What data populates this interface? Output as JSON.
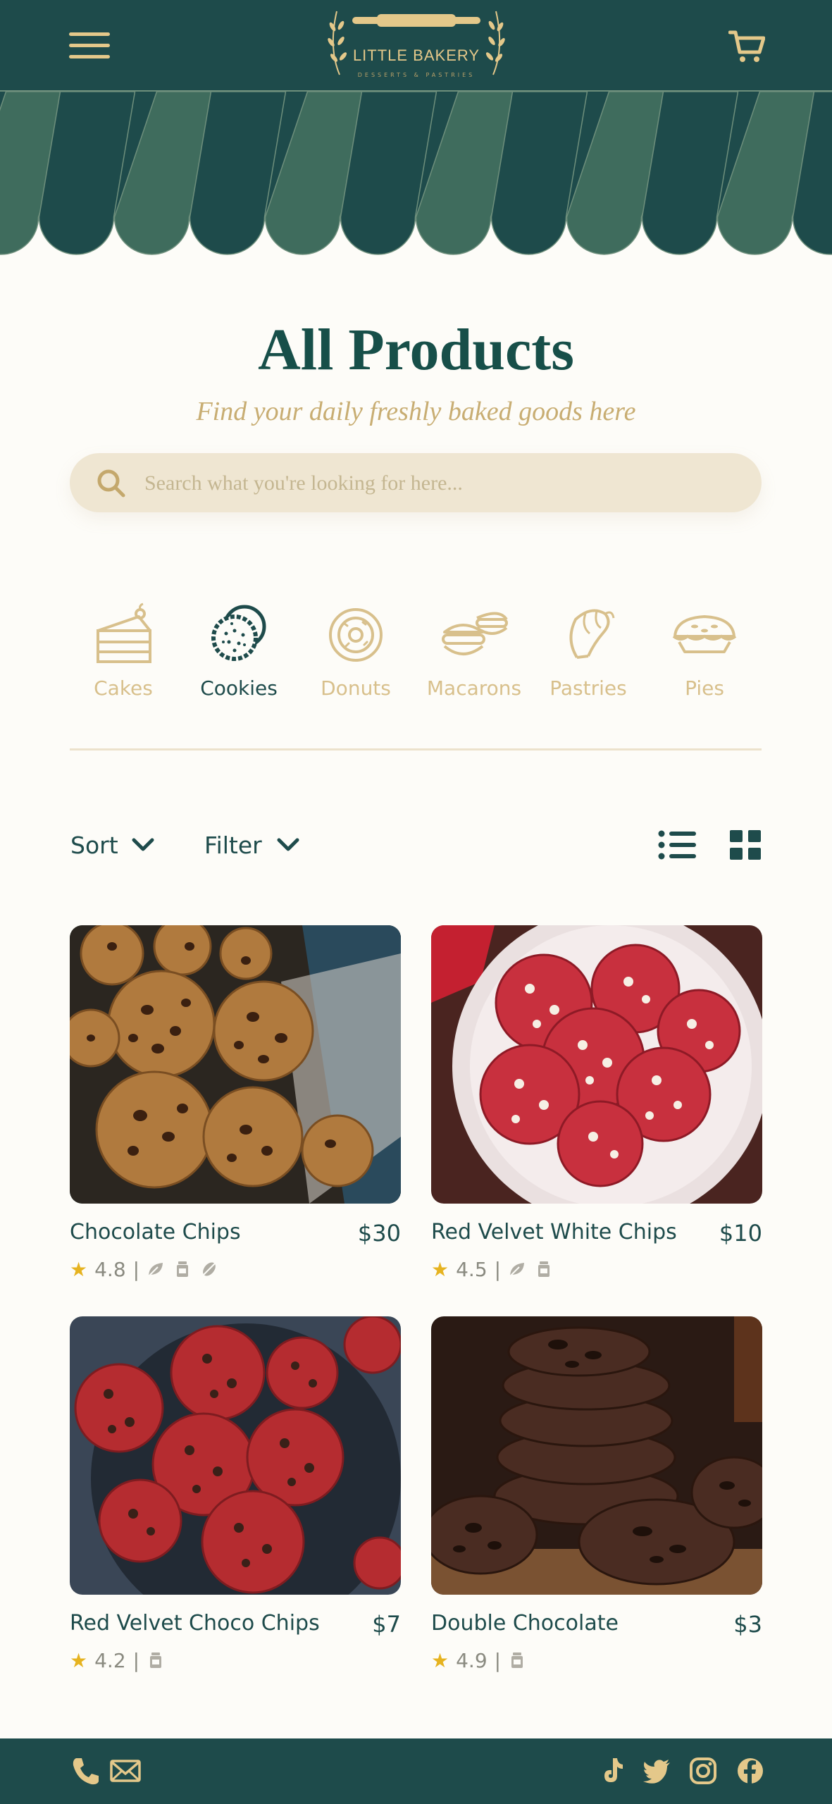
{
  "brand": {
    "name": "LITTLE BAKERY",
    "tagline": "DESSERTS & PASTRIES"
  },
  "colors": {
    "primary": "#1e4b4b",
    "awning_alt": "#3f6c5d",
    "gold": "#d8c08c",
    "background": "#fdfcf8",
    "search_bg": "#efe6d2",
    "star": "#e6b320"
  },
  "page": {
    "title": "All Products",
    "subtitle": "Find your daily freshly baked goods here"
  },
  "search": {
    "placeholder": "Search what you're looking for here..."
  },
  "categories": [
    {
      "label": "Cakes",
      "icon": "cake-icon",
      "active": false
    },
    {
      "label": "Cookies",
      "icon": "cookie-icon",
      "active": true
    },
    {
      "label": "Donuts",
      "icon": "donut-icon",
      "active": false
    },
    {
      "label": "Macarons",
      "icon": "macaron-icon",
      "active": false
    },
    {
      "label": "Pastries",
      "icon": "croissant-icon",
      "active": false
    },
    {
      "label": "Pies",
      "icon": "pie-icon",
      "active": false
    }
  ],
  "toolbar": {
    "sort_label": "Sort",
    "filter_label": "Filter"
  },
  "products": [
    {
      "name": "Chocolate Chips",
      "price": "$30",
      "rating": "4.8",
      "tags": [
        "vegan-leaf-icon",
        "jar-icon",
        "gluten-free-icon"
      ]
    },
    {
      "name": "Red Velvet White Chips",
      "price": "$10",
      "rating": "4.5",
      "tags": [
        "vegan-leaf-icon",
        "jar-icon"
      ]
    },
    {
      "name": "Red Velvet Choco Chips",
      "price": "$7",
      "rating": "4.2",
      "tags": [
        "jar-icon"
      ]
    },
    {
      "name": "Double Chocolate",
      "price": "$3",
      "rating": "4.9",
      "tags": [
        "jar-icon"
      ]
    }
  ],
  "footer": {
    "contact_icons": [
      "phone-icon",
      "mail-icon"
    ],
    "social_icons": [
      "tiktok-icon",
      "twitter-icon",
      "instagram-icon",
      "facebook-icon"
    ]
  }
}
